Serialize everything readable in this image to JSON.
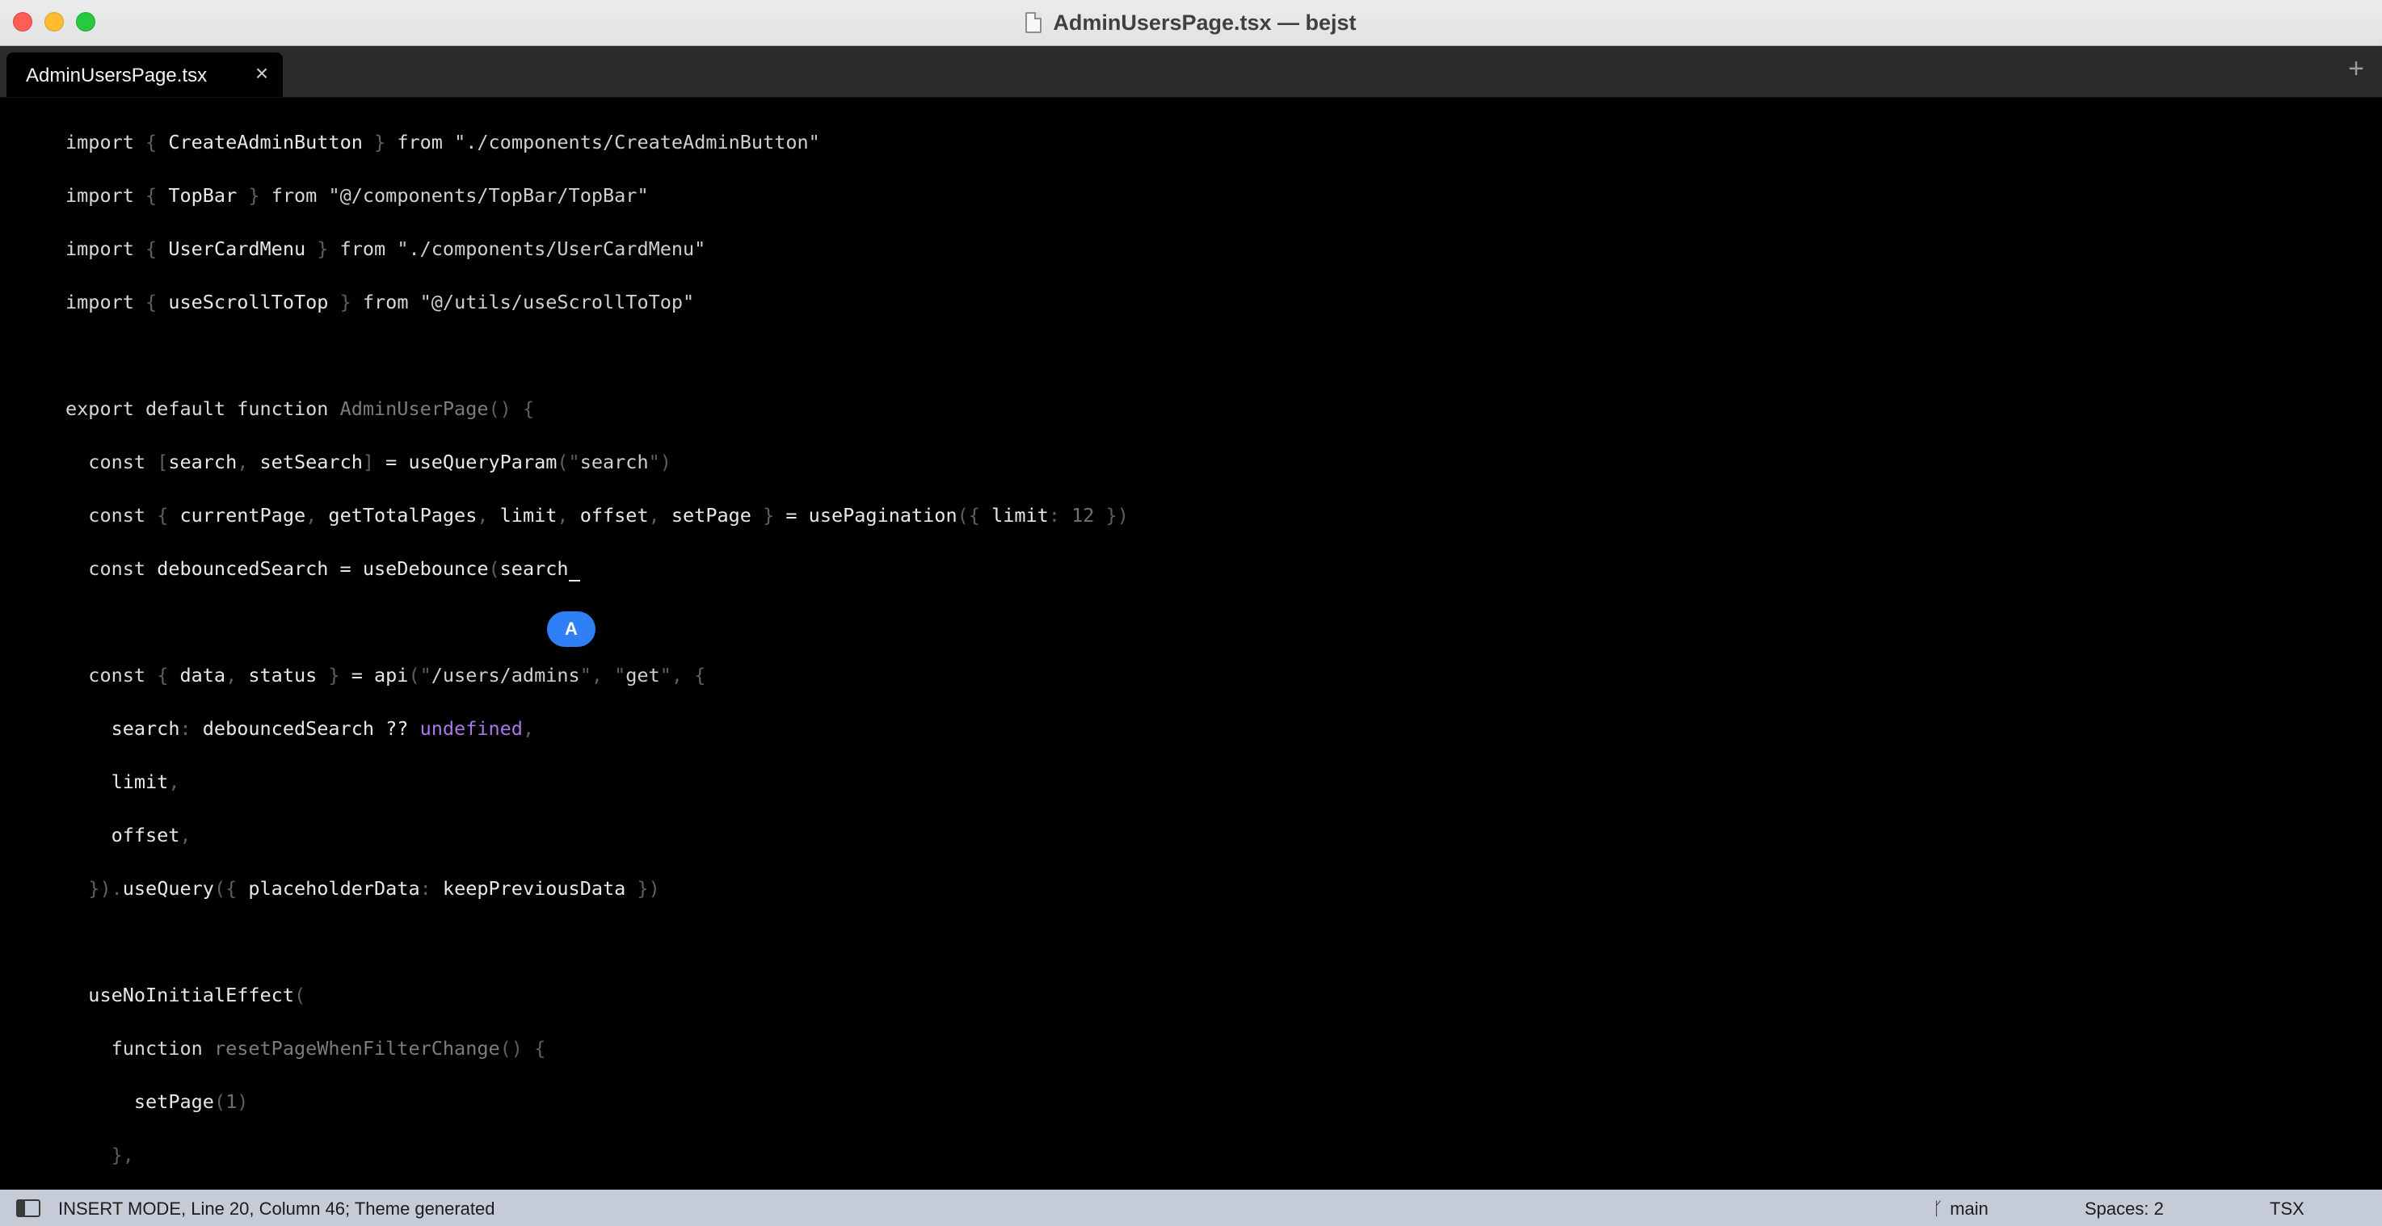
{
  "window": {
    "title": "AdminUsersPage.tsx — bejst"
  },
  "tabs": [
    {
      "label": "AdminUsersPage.tsx",
      "close_glyph": "×"
    }
  ],
  "new_tab_glyph": "+",
  "cursor_badge": "A",
  "status": {
    "mode_text": "INSERT MODE, Line 20, Column 46; Theme generated",
    "branch": "main",
    "spaces": "Spaces: 2",
    "syntax": "TSX"
  },
  "icons": {
    "traffic_lights": [
      "close-icon",
      "minimize-icon",
      "zoom-icon"
    ],
    "title": "document-icon",
    "tab_close": "close-icon",
    "new_tab": "plus-icon",
    "sidebar": "sidebar-icon",
    "branch": "git-branch-icon"
  },
  "colors": {
    "accent": "#2f7ff5",
    "statusbar": "#c6ccd7",
    "undefined_keyword": "#a879e6"
  },
  "code": [
    [
      [
        "kw",
        "import "
      ],
      [
        "pn",
        "{ "
      ],
      [
        "tx",
        "CreateAdminButton"
      ],
      [
        "pn",
        " } "
      ],
      [
        "kw",
        "from "
      ],
      [
        "st",
        "\"./components/CreateAdminButton\""
      ]
    ],
    [
      [
        "kw",
        "import "
      ],
      [
        "pn",
        "{ "
      ],
      [
        "tx",
        "TopBar"
      ],
      [
        "pn",
        " } "
      ],
      [
        "kw",
        "from "
      ],
      [
        "st",
        "\"@/components/TopBar/TopBar\""
      ]
    ],
    [
      [
        "kw",
        "import "
      ],
      [
        "pn",
        "{ "
      ],
      [
        "tx",
        "UserCardMenu"
      ],
      [
        "pn",
        " } "
      ],
      [
        "kw",
        "from "
      ],
      [
        "st",
        "\"./components/UserCardMenu\""
      ]
    ],
    [
      [
        "kw",
        "import "
      ],
      [
        "pn",
        "{ "
      ],
      [
        "tx",
        "useScrollToTop"
      ],
      [
        "pn",
        " } "
      ],
      [
        "kw",
        "from "
      ],
      [
        "st",
        "\"@/utils/useScrollToTop\""
      ]
    ],
    [],
    [
      [
        "kw",
        "export default function "
      ],
      [
        "fn",
        "AdminUserPage"
      ],
      [
        "pn",
        "() {"
      ]
    ],
    [
      [
        "tx",
        "  "
      ],
      [
        "kw",
        "const "
      ],
      [
        "pn",
        "["
      ],
      [
        "tx",
        "search"
      ],
      [
        "pn",
        ", "
      ],
      [
        "tx",
        "setSearch"
      ],
      [
        "pn",
        "]"
      ],
      [
        "tx",
        " = useQueryParam"
      ],
      [
        "pn",
        "(\""
      ],
      [
        "st",
        "search"
      ],
      [
        "pn",
        "\")"
      ]
    ],
    [
      [
        "tx",
        "  "
      ],
      [
        "kw",
        "const "
      ],
      [
        "pn",
        "{ "
      ],
      [
        "tx",
        "currentPage"
      ],
      [
        "pn",
        ", "
      ],
      [
        "tx",
        "getTotalPages"
      ],
      [
        "pn",
        ", "
      ],
      [
        "tx",
        "limit"
      ],
      [
        "pn",
        ", "
      ],
      [
        "tx",
        "offset"
      ],
      [
        "pn",
        ", "
      ],
      [
        "tx",
        "setPage"
      ],
      [
        "pn",
        " }"
      ],
      [
        "tx",
        " = usePagination"
      ],
      [
        "pn",
        "({ "
      ],
      [
        "tx",
        "limit"
      ],
      [
        "pn",
        ": "
      ],
      [
        "nm",
        "12"
      ],
      [
        "pn",
        " })"
      ]
    ],
    [
      [
        "tx",
        "  "
      ],
      [
        "kw",
        "const "
      ],
      [
        "tx",
        "debouncedSearch = useDebounce"
      ],
      [
        "pn",
        "("
      ],
      [
        "tx",
        "search"
      ],
      [
        "cur",
        " "
      ]
    ],
    [],
    [
      [
        "tx",
        "  "
      ],
      [
        "kw",
        "const "
      ],
      [
        "pn",
        "{ "
      ],
      [
        "tx",
        "data"
      ],
      [
        "pn",
        ", "
      ],
      [
        "tx",
        "status"
      ],
      [
        "pn",
        " }"
      ],
      [
        "tx",
        " = api"
      ],
      [
        "pn",
        "(\""
      ],
      [
        "st",
        "/users/admins"
      ],
      [
        "pn",
        "\", \""
      ],
      [
        "st",
        "get"
      ],
      [
        "pn",
        "\", {"
      ]
    ],
    [
      [
        "tx",
        "    search"
      ],
      [
        "pn",
        ": "
      ],
      [
        "tx",
        "debouncedSearch ?? "
      ],
      [
        "ud",
        "undefined"
      ],
      [
        "pn",
        ","
      ]
    ],
    [
      [
        "tx",
        "    limit"
      ],
      [
        "pn",
        ","
      ]
    ],
    [
      [
        "tx",
        "    offset"
      ],
      [
        "pn",
        ","
      ]
    ],
    [
      [
        "pn",
        "  })."
      ],
      [
        "tx",
        "useQuery"
      ],
      [
        "pn",
        "({ "
      ],
      [
        "tx",
        "placeholderData"
      ],
      [
        "pn",
        ": "
      ],
      [
        "tx",
        "keepPreviousData"
      ],
      [
        "pn",
        " })"
      ]
    ],
    [],
    [
      [
        "tx",
        "  useNoInitialEffect"
      ],
      [
        "pn",
        "("
      ]
    ],
    [
      [
        "tx",
        "    "
      ],
      [
        "kw",
        "function "
      ],
      [
        "fn",
        "resetPageWhenFilterChange"
      ],
      [
        "pn",
        "() {"
      ]
    ],
    [
      [
        "tx",
        "      setPage"
      ],
      [
        "pn",
        "("
      ],
      [
        "nm",
        "1"
      ],
      [
        "pn",
        ")"
      ]
    ],
    [
      [
        "pn",
        "    },"
      ]
    ]
  ]
}
